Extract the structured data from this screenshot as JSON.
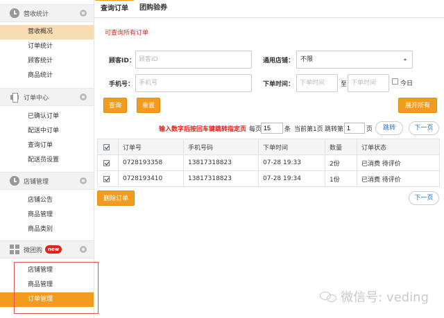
{
  "sidebar": {
    "sections": [
      {
        "title": "营收统计",
        "items": [
          {
            "label": "营收概况",
            "state": "soft"
          },
          {
            "label": "订单统计",
            "state": ""
          },
          {
            "label": "顾客统计",
            "state": ""
          },
          {
            "label": "商品统计",
            "state": ""
          }
        ]
      },
      {
        "title": "订单中心",
        "items": [
          {
            "label": "已确认订单",
            "state": ""
          },
          {
            "label": "配送中订单",
            "state": ""
          },
          {
            "label": "查询订单",
            "state": ""
          },
          {
            "label": "配送员设置",
            "state": ""
          }
        ]
      },
      {
        "title": "店铺管理",
        "items": [
          {
            "label": "店铺公告",
            "state": ""
          },
          {
            "label": "商品管理",
            "state": ""
          },
          {
            "label": "商品类别",
            "state": ""
          }
        ]
      },
      {
        "title": "微团购",
        "badge": "new",
        "items": [
          {
            "label": "店铺管理",
            "state": ""
          },
          {
            "label": "商品管理",
            "state": ""
          },
          {
            "label": "订单管理",
            "state": "active"
          }
        ]
      }
    ]
  },
  "tabs": [
    "查询订单",
    "团购验券"
  ],
  "hint": "可查询所有订单",
  "form": {
    "customer_label": "顾客ID：",
    "customer_placeholder": "顾客ID",
    "phone_label": "手机号：",
    "phone_placeholder": "手机号",
    "shop_label": "通用店铺：",
    "shop_value": "不限",
    "time_label": "下单时间：",
    "time_from_placeholder": "下单时间",
    "time_to_label": "至",
    "time_to_placeholder": "下单时间",
    "today_label": "今日"
  },
  "buttons": {
    "query": "查询",
    "reset": "重置",
    "expand_all": "展开所有",
    "delete_order": "删除订单"
  },
  "pagination": {
    "instruction": "输入数字后按回车键跳转指定页",
    "per_page_prefix": "每页",
    "per_page_value": "15",
    "per_page_suffix": "条",
    "current": "当前第1页",
    "jump_prefix": "跳转第",
    "jump_value": "1",
    "jump_suffix": "页",
    "jump_button": "跳转",
    "next_button": "下一页"
  },
  "table": {
    "headers": [
      "订单号",
      "手机号码",
      "下单时间",
      "数量",
      "订单状态"
    ],
    "rows": [
      [
        "0728193358",
        "13817318823",
        "07-28 19:33",
        "2份",
        "已消费 待评价"
      ],
      [
        "0728193410",
        "13817318823",
        "07-28 19:34",
        "1份",
        "已消费 待评价"
      ]
    ]
  },
  "watermark": "微信号: veding"
}
